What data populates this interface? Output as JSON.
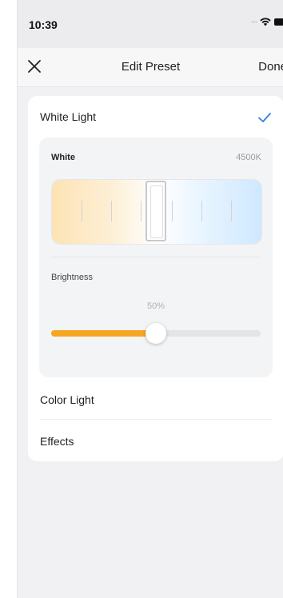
{
  "status_bar": {
    "time": "10:39",
    "signal_dots": "....",
    "wifi_icon": "wifi-icon",
    "battery_icon": "battery-icon"
  },
  "nav": {
    "close_icon": "close-icon",
    "title": "Edit Preset",
    "done_label": "Done"
  },
  "white_light": {
    "title": "White Light",
    "selected": true,
    "check_color": "#2f7fe5",
    "white": {
      "label": "White",
      "value": "4500K"
    },
    "brightness": {
      "label": "Brightness",
      "value": "50%",
      "fraction": 0.5,
      "accent": "#f5a623"
    }
  },
  "options": [
    {
      "label": "Color Light"
    },
    {
      "label": "Effects"
    }
  ]
}
